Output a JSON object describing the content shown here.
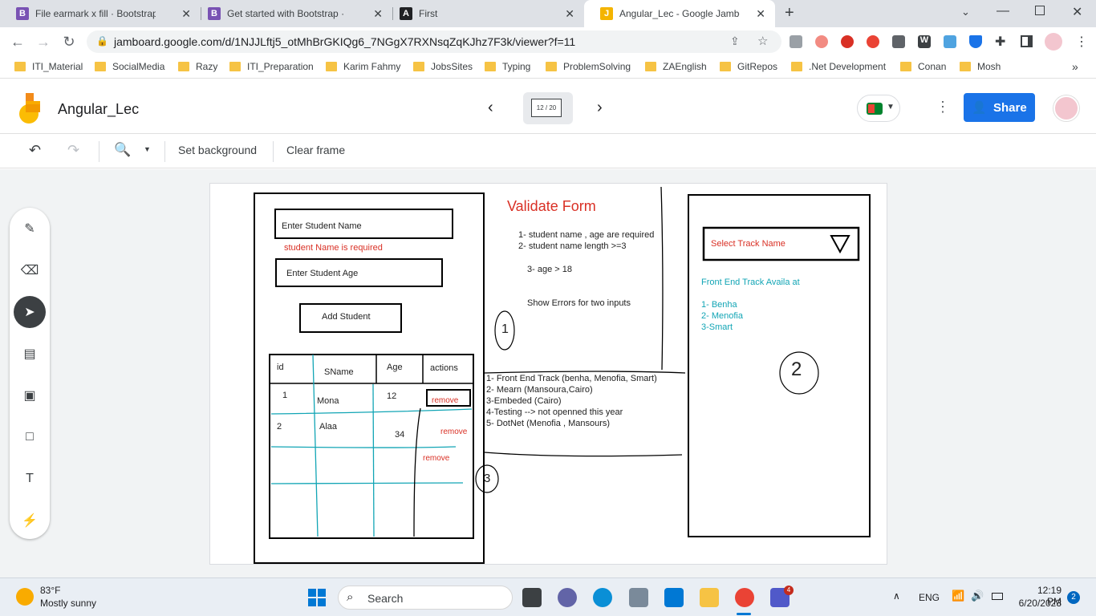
{
  "browser": {
    "tabs": [
      {
        "title": "File earmark x fill · Bootstrap Icon",
        "favicon": "B",
        "color": "#7952b3"
      },
      {
        "title": "Get started with Bootstrap · Boot",
        "favicon": "B",
        "color": "#7952b3"
      },
      {
        "title": "First",
        "favicon": "A",
        "color": "#202124"
      },
      {
        "title": "Angular_Lec - Google Jamboard",
        "favicon": "J",
        "color": "#f4b400"
      }
    ],
    "url": "jamboard.google.com/d/1NJJLftj5_otMhBrGKIQg6_7NGgX7RXNsqZqKJhz7F3k/viewer?f=11",
    "bookmarks": [
      "ITI_Material",
      "SocialMedia",
      "Razy",
      "ITI_Preparation",
      "Karim Fahmy",
      "JobsSites",
      "Typing",
      "ProblemSolving",
      "ZAEnglish",
      "GitRepos",
      ".Net Development",
      "Conan",
      "Mosh"
    ]
  },
  "jamboard": {
    "title": "Angular_Lec",
    "frame_indicator": "12 / 20",
    "share_label": "Share",
    "toolbar": {
      "set_background": "Set background",
      "clear_frame": "Clear frame"
    }
  },
  "sketch": {
    "form": {
      "name_input": "Enter Student Name",
      "name_error": "student Name is required",
      "age_input": "Enter Student Age",
      "add_button": "Add Student"
    },
    "table": {
      "headers": [
        "id",
        "SName",
        "Age",
        "actions"
      ],
      "rows": [
        {
          "id": "1",
          "name": "Mona",
          "age": "12",
          "action": "remove"
        },
        {
          "id": "2",
          "name": "Alaa",
          "age": "34",
          "action": "remove"
        },
        {
          "id": "",
          "name": "",
          "age": "",
          "action": "remove"
        }
      ]
    },
    "validate": {
      "title": "Validate Form",
      "rule1": "1- student name , age are required",
      "rule2": "2- student name length >=3",
      "rule3": "3- age > 18",
      "rule4": "Show Errors for two inputs",
      "circle": "1"
    },
    "tracks_list": [
      "1- Front End Track (benha, Menofia, Smart)",
      "2- Mearn (Mansoura,Cairo)",
      "3-Embeded (Cairo)",
      "4-Testing --> not openned this year",
      "5- DotNet (Menofia , Mansours)"
    ],
    "circle3": "3",
    "select": {
      "placeholder": "Select Track Name",
      "avail_title": "Front End Track Availa at",
      "avail_items": [
        "1- Benha",
        "2- Menofia",
        "3-Smart"
      ],
      "circle": "2"
    }
  },
  "taskbar": {
    "weather_temp": "83°F",
    "weather_desc": "Mostly sunny",
    "search_label": "Search",
    "lang": "ENG",
    "time": "12:19 PM",
    "date": "6/20/2023",
    "notif_count": "2",
    "teams_badge": "4"
  }
}
